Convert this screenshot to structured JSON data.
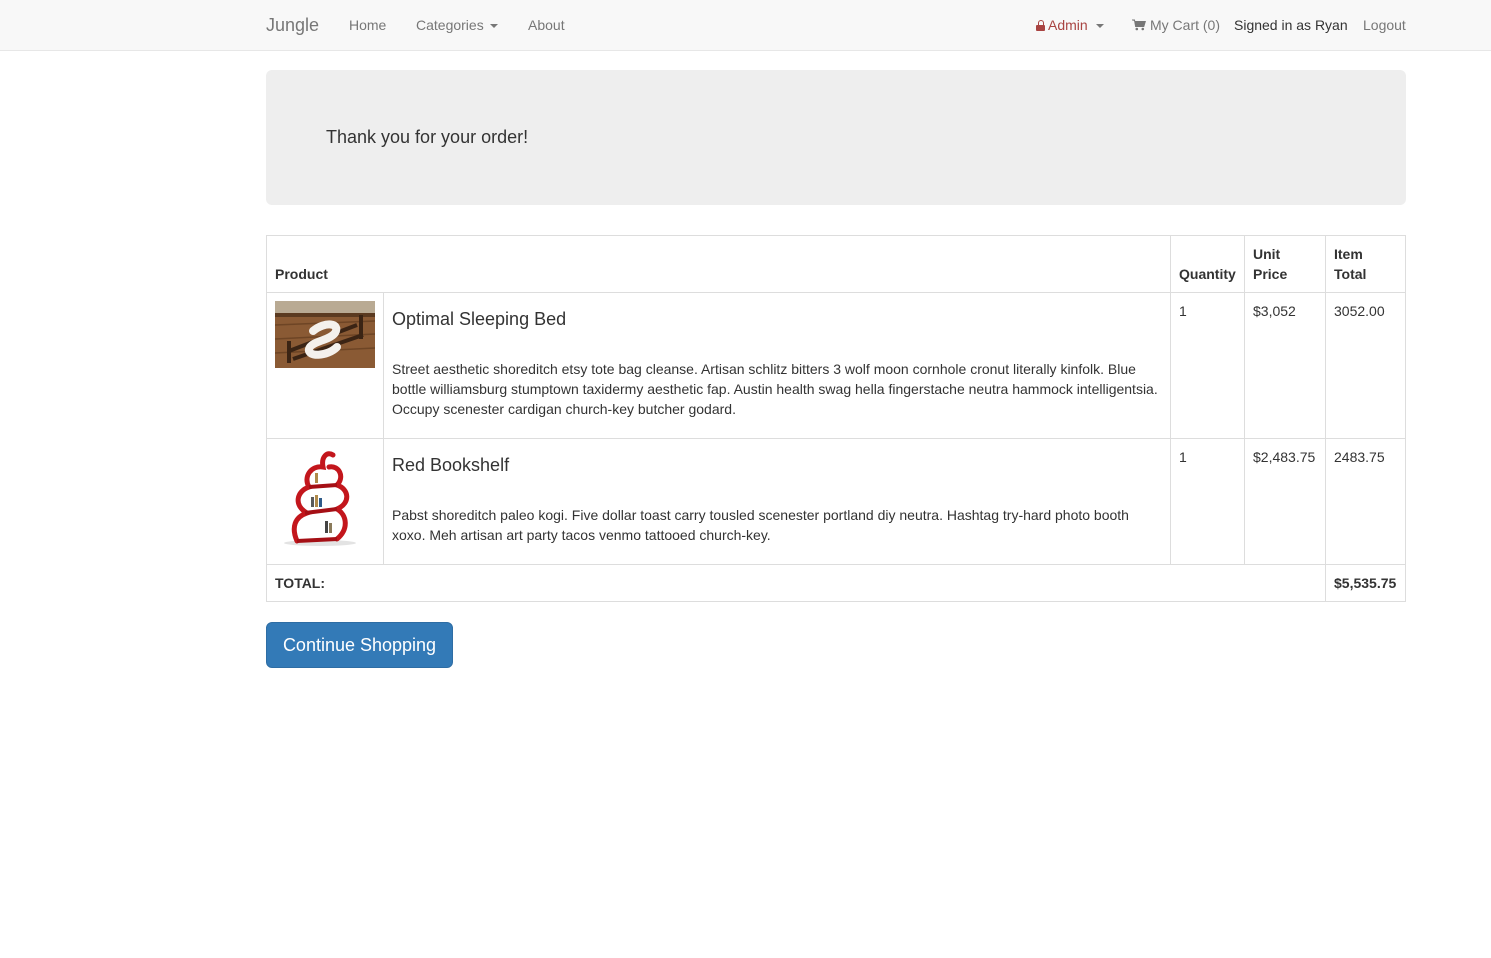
{
  "nav": {
    "brand": "Jungle",
    "home": "Home",
    "categories": "Categories",
    "about": "About",
    "admin": "Admin",
    "cart": "My Cart (0)",
    "signed_in": "Signed in as Ryan",
    "logout": "Logout"
  },
  "banner": {
    "message": "Thank you for your order!"
  },
  "table": {
    "headers": {
      "product": "Product",
      "quantity": "Quantity",
      "unit_price": "Unit Price",
      "item_total": "Item Total"
    },
    "rows": [
      {
        "name": "Optimal Sleeping Bed",
        "description": "Street aesthetic shoreditch etsy tote bag cleanse. Artisan schlitz bitters 3 wolf moon cornhole cronut literally kinfolk. Blue bottle williamsburg stumptown taxidermy aesthetic fap. Austin health swag hella fingerstache neutra hammock intelligentsia. Occupy scenester cardigan church-key butcher godard.",
        "quantity": "1",
        "unit_price": "$3,052",
        "item_total": "3052.00"
      },
      {
        "name": "Red Bookshelf",
        "description": "Pabst shoreditch paleo kogi. Five dollar toast carry tousled scenester portland diy neutra. Hashtag try-hard photo booth xoxo. Meh artisan art party tacos venmo tattooed church-key.",
        "quantity": "1",
        "unit_price": "$2,483.75",
        "item_total": "2483.75"
      }
    ],
    "footer": {
      "label": "TOTAL:",
      "total": "$5,535.75"
    }
  },
  "actions": {
    "continue": "Continue Shopping"
  },
  "colors": {
    "primary": "#337ab7",
    "admin": "#a94442",
    "navbar_bg": "#f8f8f8",
    "jumbotron_bg": "#eeeeee"
  },
  "icons": {
    "admin": "lock-icon",
    "cart": "shopping-cart-icon"
  }
}
